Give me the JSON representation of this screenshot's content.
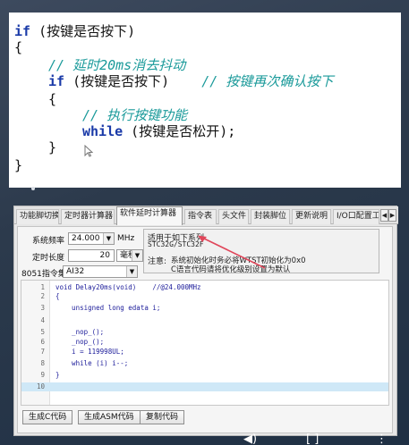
{
  "slide": {
    "lines": [
      {
        "kw": "if",
        "text": " (按键是否按下)"
      },
      {
        "text": "{"
      },
      {
        "comment": "// 延时20ms消去抖动"
      },
      {
        "kw": "if",
        "text": " (按键是否按下)",
        "comment": "// 按键再次确认按下"
      },
      {
        "text": "{"
      },
      {
        "comment": "// 执行按键功能"
      },
      {
        "kw": "while",
        "text": " (按键是否松开);"
      },
      {
        "text": "}"
      },
      {
        "text": "}"
      }
    ]
  },
  "window": {
    "tabs": [
      {
        "label": "功能脚切换"
      },
      {
        "label": "定时器计算器"
      },
      {
        "label": "软件延时计算器"
      },
      {
        "label": "指令表"
      },
      {
        "label": "头文件"
      },
      {
        "label": "封装脚位"
      },
      {
        "label": "更新说明"
      },
      {
        "label": "I/O口配置工具"
      }
    ],
    "tab_arrows": [
      "◀",
      "▶"
    ],
    "form": {
      "freq_label": "系统频率",
      "freq_value": "24.000",
      "freq_unit": "MHz",
      "duration_label": "定时长度",
      "duration_value": "20",
      "duration_unit": "毫秒",
      "instr_label": "8051指令集",
      "instr_value": "AI32"
    },
    "family": {
      "applies_label": "适用于如下系列",
      "series": "STC32G/STC32F",
      "note_label": "注意:",
      "note_line1": "系统初始化时务必将WTST初始化为0x0",
      "note_line2": "C语言代码请将优化级别设置为默认"
    },
    "code": [
      {
        "n": "1",
        "code": "void Delay20ms(void)    //@24.000MHz"
      },
      {
        "n": "2",
        "code": "{"
      },
      {
        "n": "3",
        "code": "    unsigned long edata i;"
      },
      {
        "n": "4",
        "code": ""
      },
      {
        "n": "5",
        "code": "    _nop_();"
      },
      {
        "n": "6",
        "code": "    _nop_();"
      },
      {
        "n": "7",
        "code": "    i = 119998UL;"
      },
      {
        "n": "8",
        "code": "    while (i) i--;"
      },
      {
        "n": "9",
        "code": "}"
      },
      {
        "n": "10",
        "code": ""
      }
    ],
    "buttons": {
      "gen_c": "生成C代码",
      "gen_asm": "生成ASM代码",
      "copy": "复制代码"
    }
  },
  "player": {
    "controls": [
      "◀)",
      "[ ]",
      "⋮"
    ]
  },
  "colors": {
    "keyword": "#1a3aa8",
    "comment": "#1a9a9a",
    "highlight_row": "#cfe8f7",
    "arrow": "#e0465a"
  }
}
